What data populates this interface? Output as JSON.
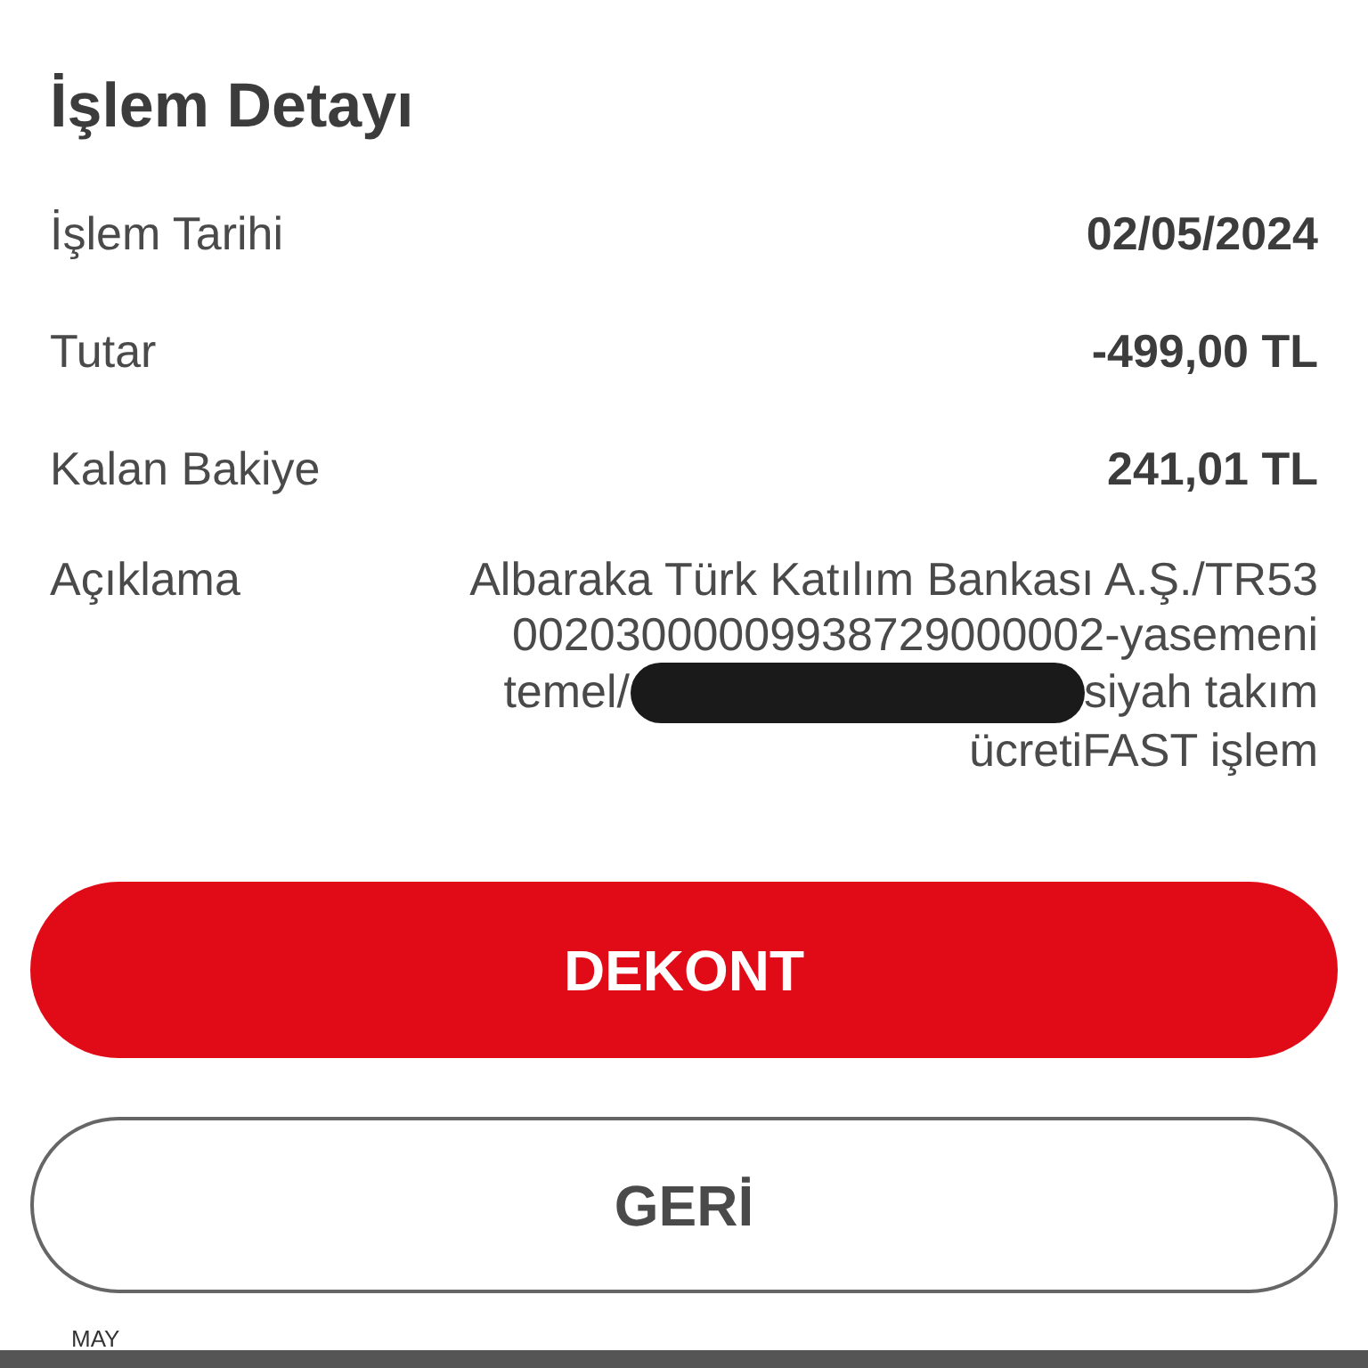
{
  "title": "İşlem Detayı",
  "fields": [
    {
      "label": "İşlem Tarihi",
      "value": "02/05/2024"
    },
    {
      "label": "Tutar",
      "value": "-499,00 TL"
    },
    {
      "label": "Kalan Bakiye",
      "value": "241,01 TL"
    }
  ],
  "description": {
    "label": "Açıklama",
    "lines": [
      {
        "kind": "text",
        "parts": [
          "Albaraka Türk Katılım Bankası A.Ş./TR53"
        ]
      },
      {
        "kind": "text",
        "parts": [
          "00203000009938729000002-yasemeni"
        ]
      },
      {
        "kind": "redacted",
        "parts": [
          "temel/",
          "siyah takım"
        ]
      },
      {
        "kind": "text",
        "parts": [
          "ücretiFAST işlem"
        ]
      }
    ]
  },
  "buttons": [
    {
      "label": "DEKONT",
      "kind": "primary"
    },
    {
      "label": "GERİ",
      "kind": "secondary"
    }
  ],
  "footer": {
    "label": "MAY"
  }
}
